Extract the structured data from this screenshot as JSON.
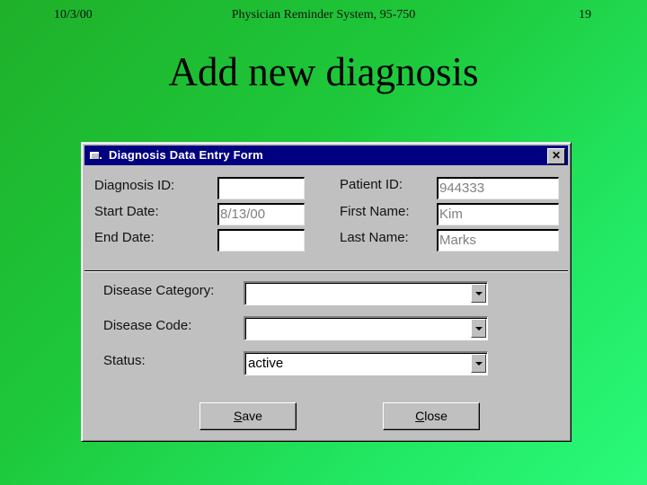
{
  "slide": {
    "date": "10/3/00",
    "course": "Physician Reminder System, 95-750",
    "page_number": "19",
    "title": "Add new diagnosis"
  },
  "window": {
    "title": "Diagnosis Data Entry Form",
    "icon": "form-window-icon",
    "close_glyph": "✕"
  },
  "fields": {
    "diagnosis_id": {
      "label": "Diagnosis ID:",
      "value": ""
    },
    "start_date": {
      "label": "Start Date:",
      "value": "8/13/00"
    },
    "end_date": {
      "label": "End Date:",
      "value": ""
    },
    "patient_id": {
      "label": "Patient ID:",
      "value": "944333"
    },
    "first_name": {
      "label": "First Name:",
      "value": "Kim"
    },
    "last_name": {
      "label": "Last Name:",
      "value": "Marks"
    }
  },
  "combos": {
    "disease_category": {
      "label": "Disease Category:",
      "value": ""
    },
    "disease_code": {
      "label": "Disease Code:",
      "value": ""
    },
    "status": {
      "label": "Status:",
      "value": "active"
    }
  },
  "buttons": {
    "save": {
      "accel": "S",
      "rest": "ave"
    },
    "close": {
      "accel": "C",
      "rest": "lose"
    }
  }
}
